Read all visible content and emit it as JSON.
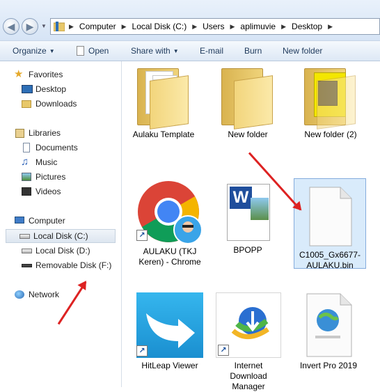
{
  "address": {
    "segments": [
      "Computer",
      "Local Disk (C:)",
      "Users",
      "aplimuvie",
      "Desktop"
    ]
  },
  "toolbar": {
    "organize": "Organize",
    "open": "Open",
    "share_with": "Share with",
    "email": "E-mail",
    "burn": "Burn",
    "new_folder": "New folder"
  },
  "nav": {
    "favorites": "Favorites",
    "desktop": "Desktop",
    "downloads": "Downloads",
    "libraries": "Libraries",
    "documents": "Documents",
    "music": "Music",
    "pictures": "Pictures",
    "videos": "Videos",
    "computer": "Computer",
    "local_c": "Local Disk (C:)",
    "local_d": "Local Disk (D:)",
    "removable_f": "Removable Disk (F:)",
    "network": "Network"
  },
  "files": [
    {
      "name": "Aulaku Template",
      "type": "folder"
    },
    {
      "name": "New folder",
      "type": "folder"
    },
    {
      "name": "New folder (2)",
      "type": "folder"
    },
    {
      "name": "AULAKU (TKJ Keren) - Chrome",
      "type": "shortcut"
    },
    {
      "name": "BPOPP",
      "type": "word-document"
    },
    {
      "name": "C1005_Gx6677-AULAKU.bin",
      "type": "file"
    },
    {
      "name": "HitLeap Viewer",
      "type": "shortcut"
    },
    {
      "name": "Internet Download Manager",
      "type": "shortcut"
    },
    {
      "name": "Invert Pro 2019",
      "type": "file"
    }
  ],
  "colors": {
    "annotation_arrow": "#dd2222",
    "selection": "#d9ebfb"
  }
}
